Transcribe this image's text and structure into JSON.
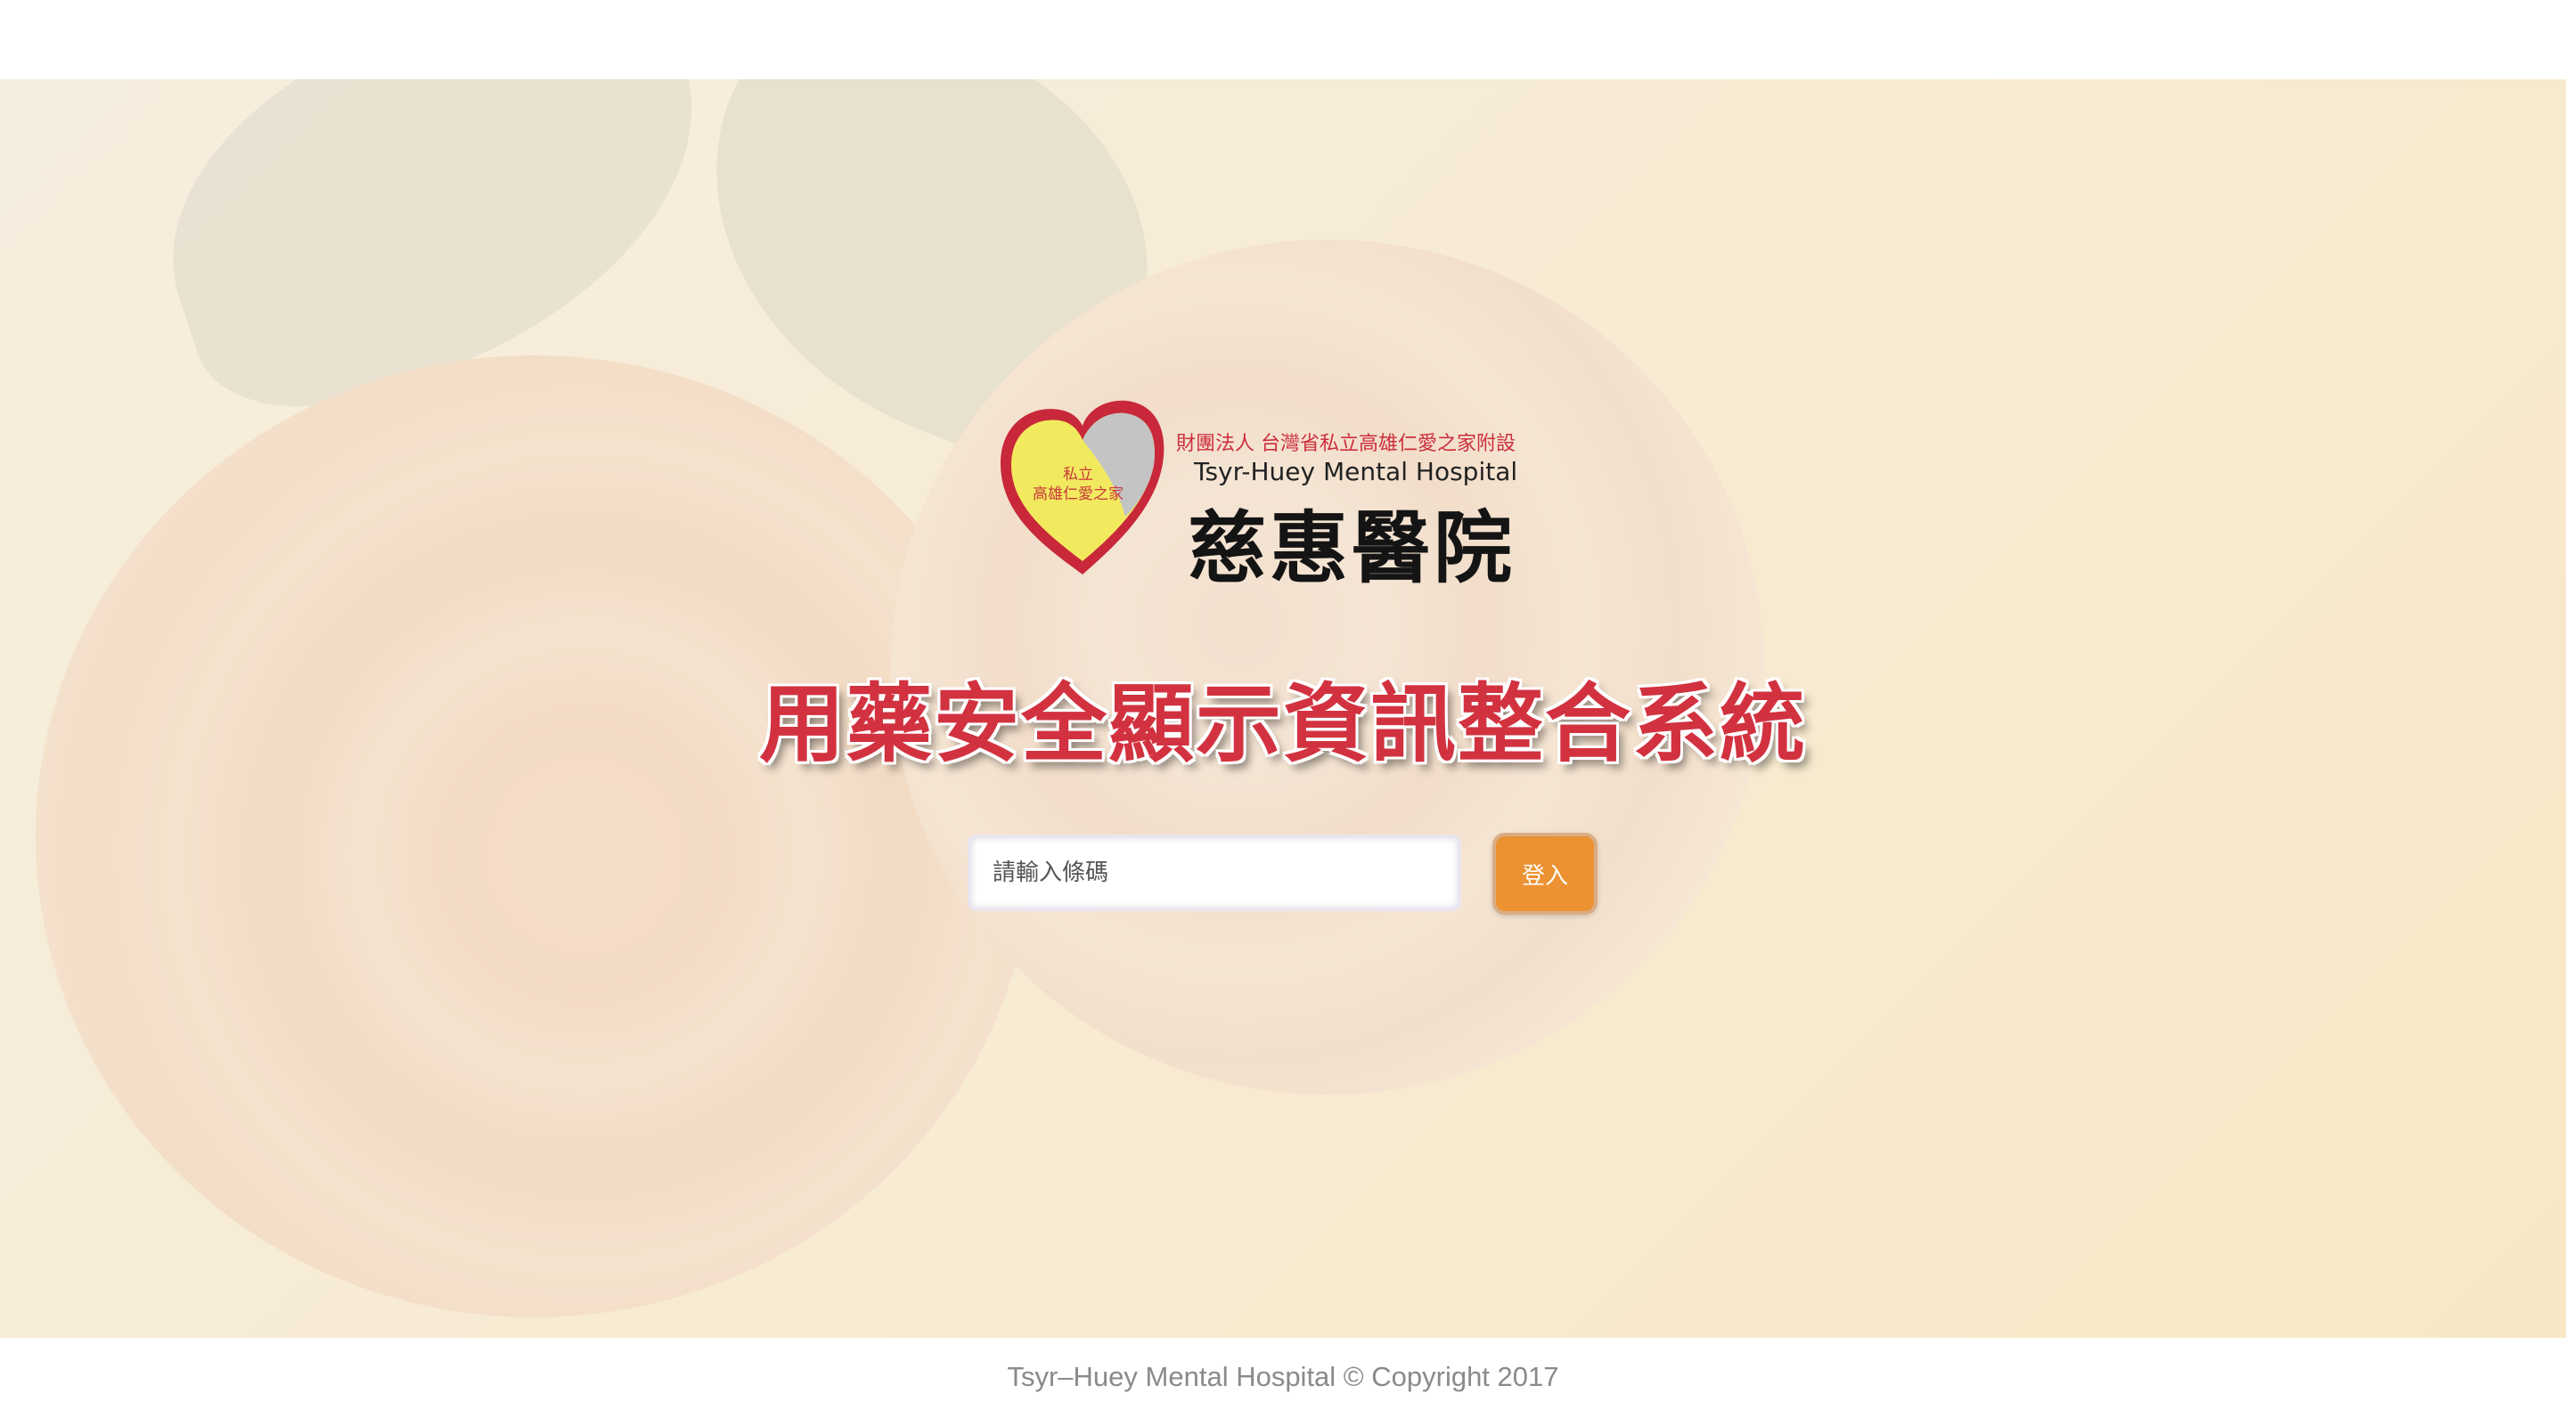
{
  "logo": {
    "foundation_text": "財團法人 台灣省私立高雄仁愛之家附設",
    "english_name": "Tsyr-Huey Mental Hospital",
    "chinese_name": "慈惠醫院",
    "heart_label_line1": "私立",
    "heart_label_line2": "高雄仁愛之家",
    "heart_colors": {
      "outline": "#c8283a",
      "fill": "#f2ea5e",
      "gray": "#c4c4c4"
    }
  },
  "system_title": "用藥安全顯示資訊整合系統",
  "login": {
    "barcode_placeholder": "請輸入條碼",
    "barcode_value": "",
    "login_button_label": "登入",
    "button_color": "#ec9232"
  },
  "footer": {
    "copyright": "Tsyr–Huey Mental Hospital © Copyright 2017"
  },
  "colors": {
    "title": "#d2323f",
    "footer_text": "#8a8a8a"
  }
}
